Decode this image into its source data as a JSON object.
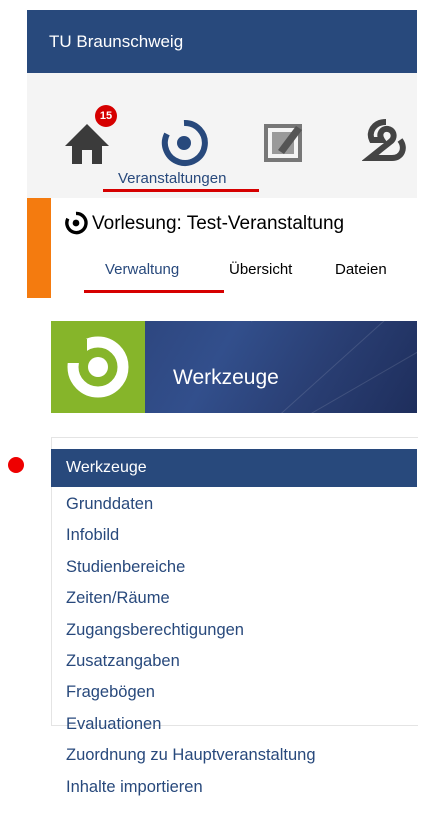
{
  "header": {
    "title": "TU Braunschweig"
  },
  "nav": {
    "badge_count": "15",
    "active_label": "Veranstaltungen",
    "icons": [
      "home-icon",
      "course-icon",
      "editor-icon",
      "community-icon"
    ]
  },
  "course": {
    "title": "Vorlesung: Test-Veranstaltung",
    "tabs": [
      "Verwaltung",
      "Übersicht",
      "Dateien"
    ]
  },
  "banner": {
    "title": "Werkzeuge"
  },
  "sidebar": {
    "heading": "Werkzeuge",
    "items": [
      "Grunddaten",
      "Infobild",
      "Studienbereiche",
      "Zeiten/Räume",
      "Zugangsberechtigungen",
      "Zusatzangaben",
      "Fragebögen",
      "Evaluationen",
      "Zuordnung zu Hauptveranstaltung",
      "Inhalte importieren"
    ]
  },
  "colors": {
    "brand": "#28497c",
    "accent_red": "#d60000",
    "orange": "#f47b0f",
    "green": "#86b52a"
  }
}
